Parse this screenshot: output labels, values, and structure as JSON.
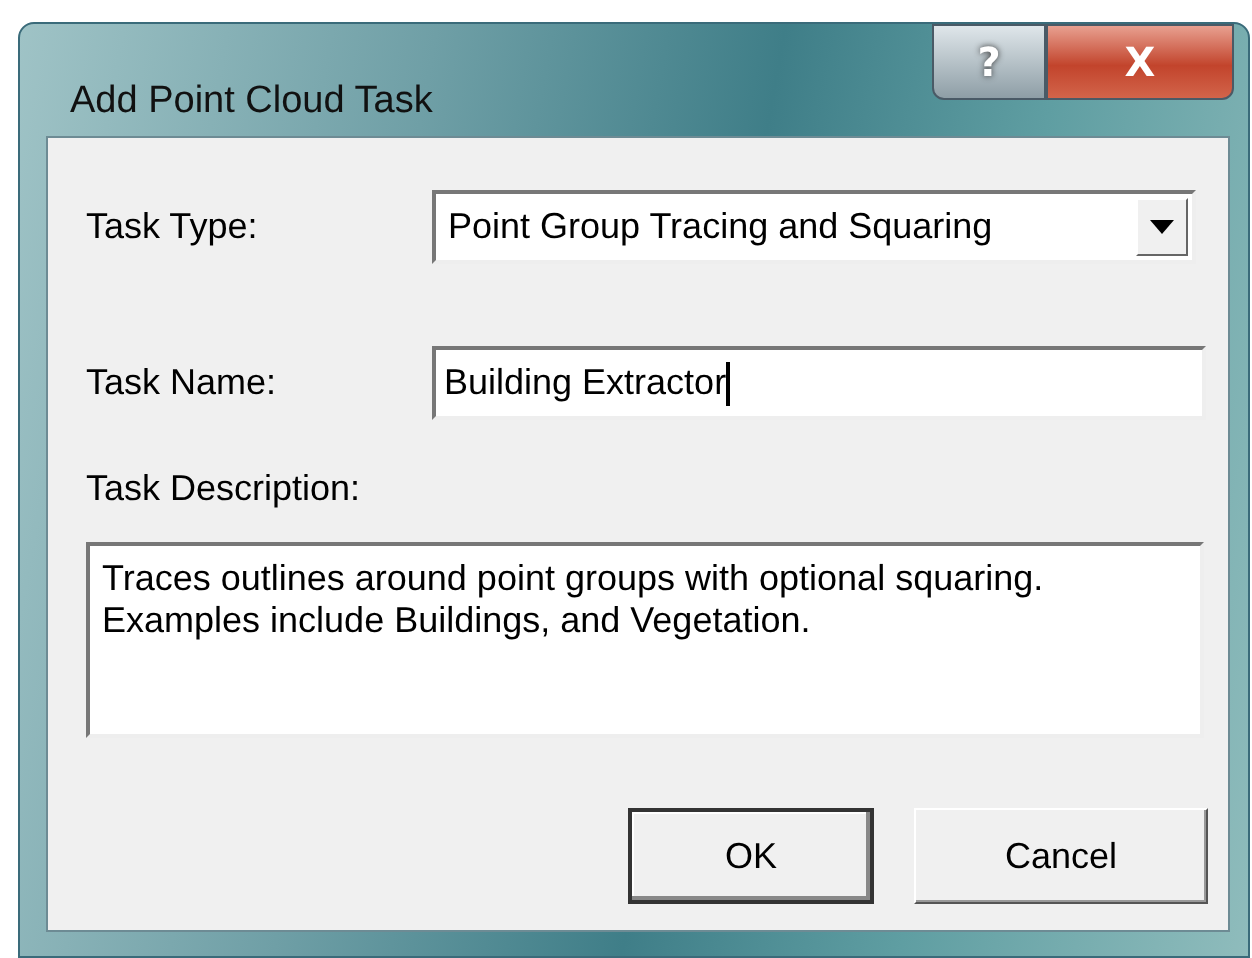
{
  "window": {
    "title": "Add Point Cloud Task",
    "help_button": "?",
    "close_button": "X"
  },
  "task_type": {
    "label": "Task Type:",
    "value": "Point Group Tracing and Squaring"
  },
  "task_name": {
    "label": "Task Name:",
    "value": "Building Extractor",
    "focused": true
  },
  "task_description": {
    "label": "Task Description:",
    "value": "Traces outlines around point groups with optional squaring. Examples include Buildings, and Vegetation."
  },
  "buttons": [
    {
      "label": "OK",
      "default": true
    },
    {
      "label": "Cancel",
      "default": false
    }
  ]
}
